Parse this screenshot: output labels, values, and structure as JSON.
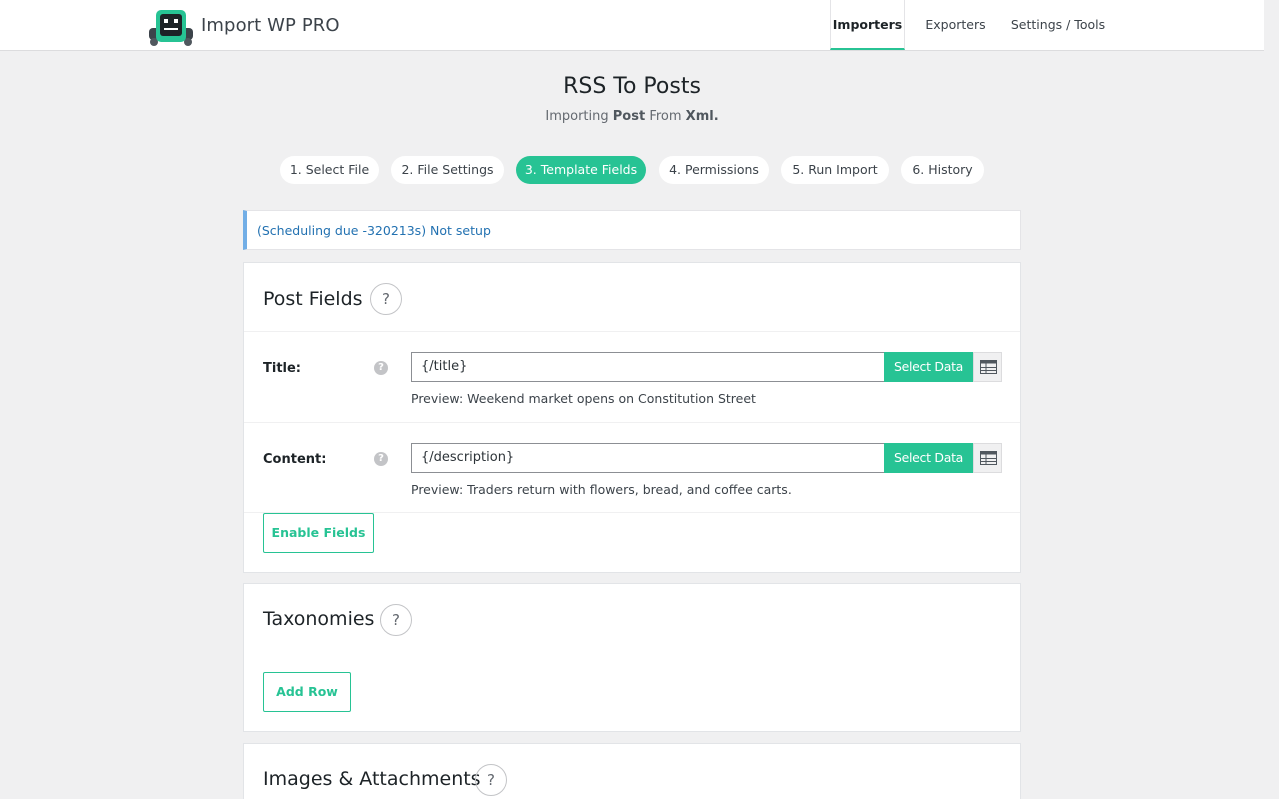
{
  "app": {
    "name": "Import WP PRO",
    "colors": {
      "accent": "#27c394",
      "notice_border": "#72aee6",
      "notice_text": "#2271b1"
    }
  },
  "nav": {
    "items": [
      {
        "label": "Importers",
        "active": true
      },
      {
        "label": "Exporters",
        "active": false
      },
      {
        "label": "Settings / Tools",
        "active": false
      }
    ]
  },
  "header": {
    "title": "RSS To Posts",
    "subtitle_prefix": "Importing",
    "subtitle_type": "Post",
    "subtitle_from": "From",
    "subtitle_format": "Xml."
  },
  "steps": [
    {
      "label": "1. Select File",
      "active": false
    },
    {
      "label": "2. File Settings",
      "active": false
    },
    {
      "label": "3. Template Fields",
      "active": true
    },
    {
      "label": "4. Permissions",
      "active": false
    },
    {
      "label": "5. Run Import",
      "active": false
    },
    {
      "label": "6. History",
      "active": false
    }
  ],
  "notice": {
    "text": "(Scheduling due -320213s) Not setup"
  },
  "post_fields": {
    "title": "Post Fields",
    "help_glyph": "?",
    "fields": [
      {
        "label": "Title:",
        "value": "{/title}",
        "button": "Select Data",
        "preview": "Preview: Weekend market opens on Constitution Street"
      },
      {
        "label": "Content:",
        "value": "{/description}",
        "button": "Select Data",
        "preview": "Preview: Traders return with flowers, bread, and coffee carts."
      }
    ],
    "enable_button": "Enable Fields"
  },
  "taxonomies": {
    "title": "Taxonomies",
    "help_glyph": "?",
    "add_button": "Add Row"
  },
  "images": {
    "title": "Images & Attachments",
    "help_glyph": "?"
  },
  "icons": {
    "logo": "robot-logo-icon",
    "field_help": "question-icon",
    "table": "table-icon"
  }
}
